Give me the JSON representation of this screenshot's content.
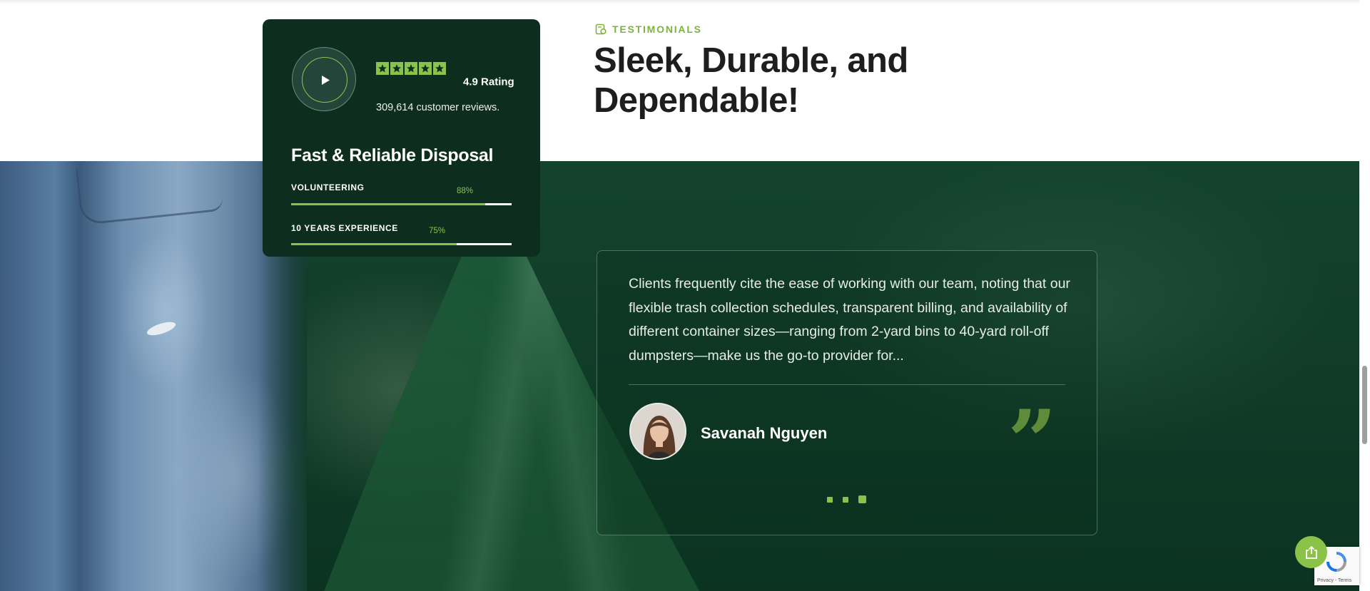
{
  "stats_card": {
    "rating_label": "4.9 Rating",
    "reviews_label": "309,614 customer reviews.",
    "star_count": 5,
    "title": "Fast & Reliable Disposal",
    "bars": [
      {
        "label": "VOLUNTEERING",
        "percent_label": "88%",
        "value": 88
      },
      {
        "label": "10 YEARS EXPERIENCE",
        "percent_label": "75%",
        "value": 75
      }
    ]
  },
  "section": {
    "eyebrow": "TESTIMONIALS",
    "headline": "Sleek, Durable, and Dependable!"
  },
  "testimonial": {
    "quote": "Clients frequently cite the ease of working with our team, noting that our flexible trash collection schedules, transparent billing, and availability of different container sizes—ranging from 2-yard bins to 40-yard roll-off dumpsters—make us the go-to provider for...",
    "author": "Savanah Nguyen",
    "slides": 3,
    "active_slide": 3
  },
  "recaptcha": {
    "footer": "Privacy - Terms"
  },
  "colors": {
    "accent": "#8bc34a",
    "card_bg": "#0d2d1f",
    "band_bg": "#14432d",
    "heading": "#1f1e1c"
  },
  "icons": {
    "play": "play-icon",
    "star": "star-icon",
    "eyebrow": "leaf-badge-icon",
    "quote": "quote-mark-icon",
    "share": "share-icon",
    "recaptcha": "recaptcha-icon"
  }
}
